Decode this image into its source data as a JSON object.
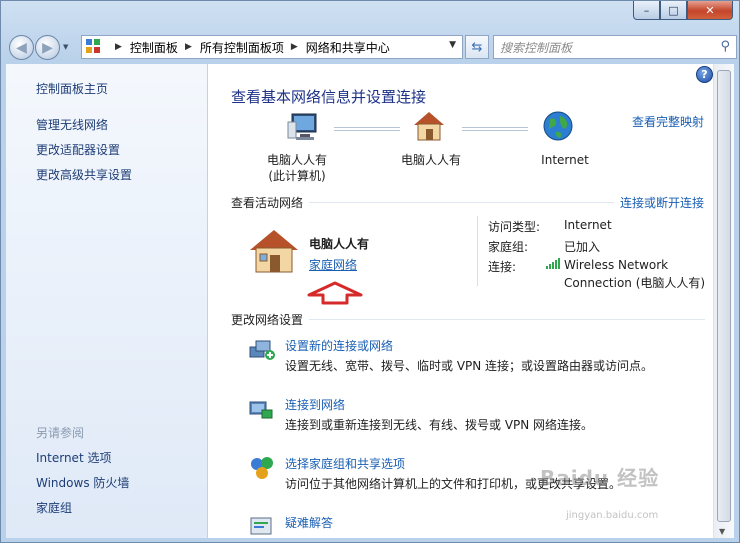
{
  "window": {
    "caption_min": "–",
    "caption_max": "□",
    "caption_close": "✕"
  },
  "nav": {
    "back_icon": "back-arrow-icon",
    "forward_icon": "forward-arrow-icon",
    "breadcrumb": [
      "控制面板",
      "所有控制面板项",
      "网络和共享中心"
    ],
    "search_placeholder": "搜索控制面板"
  },
  "sidebar": {
    "home": "控制面板主页",
    "links": [
      "管理无线网络",
      "更改适配器设置",
      "更改高级共享设置"
    ],
    "see_also_heading": "另请参阅",
    "see_also": [
      "Internet 选项",
      "Windows 防火墙",
      "家庭组"
    ]
  },
  "main": {
    "title": "查看基本网络信息并设置连接",
    "view_full_map": "查看完整映射",
    "map": {
      "computer_line1": "电脑人人有",
      "computer_line2": "(此计算机)",
      "network": "电脑人人有",
      "internet": "Internet"
    },
    "active_heading": "查看活动网络",
    "connect_disconnect": "连接或断开连接",
    "active_network": {
      "name": "电脑人人有",
      "type": "家庭网络",
      "access_type_label": "访问类型:",
      "access_type_value": "Internet",
      "homegroup_label": "家庭组:",
      "homegroup_value": "已加入",
      "connection_label": "连接:",
      "connection_value_line1": "Wireless Network",
      "connection_value_line2": "Connection (电脑人人有)"
    },
    "change_heading": "更改网络设置",
    "tasks": [
      {
        "title": "设置新的连接或网络",
        "desc": "设置无线、宽带、拨号、临时或 VPN 连接；或设置路由器或访问点。"
      },
      {
        "title": "连接到网络",
        "desc": "连接到或重新连接到无线、有线、拨号或 VPN 网络连接。"
      },
      {
        "title": "选择家庭组和共享选项",
        "desc": "访问位于其他网络计算机上的文件和打印机，或更改共享设置。"
      },
      {
        "title": "疑难解答",
        "desc": ""
      }
    ]
  },
  "watermark": {
    "text": "Baidu 经验",
    "sub": "jingyan.baidu.com"
  },
  "colors": {
    "link": "#1a5fb4",
    "title": "#1e3287",
    "sidebar_link": "#1e3d76",
    "annotation_arrow": "#d62a2a"
  }
}
